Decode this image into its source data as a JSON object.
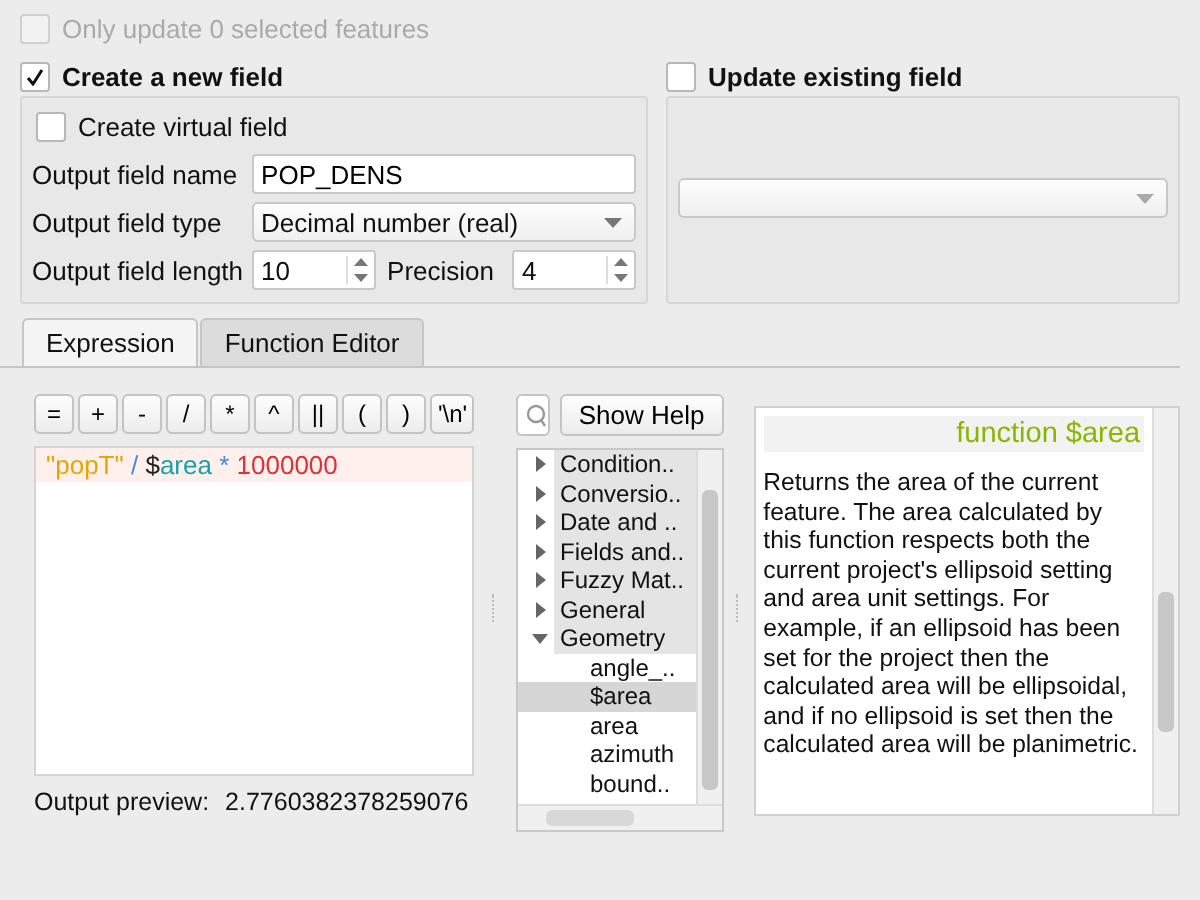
{
  "only_update": {
    "label": "Only update 0 selected features",
    "checked": false,
    "disabled": true
  },
  "create_new": {
    "label": "Create a new field",
    "checked": true,
    "virtual": {
      "label": "Create virtual field",
      "checked": false
    },
    "name_label": "Output field name",
    "name_value": "POP_DENS",
    "type_label": "Output field type",
    "type_value": "Decimal number (real)",
    "length_label": "Output field length",
    "length_value": "10",
    "precision_label": "Precision",
    "precision_value": "4"
  },
  "update_existing": {
    "label": "Update existing field",
    "checked": false
  },
  "tabs": [
    {
      "label": "Expression",
      "selected": true
    },
    {
      "label": "Function Editor",
      "selected": false
    }
  ],
  "operators": [
    "=",
    "+",
    "-",
    "/",
    "*",
    "^",
    "||",
    "(",
    ")",
    "'\\n'"
  ],
  "expression": [
    {
      "text": "\"popT\"",
      "kind": "string"
    },
    {
      "text": " / ",
      "kind": "operator"
    },
    {
      "text": "$",
      "kind": "plain"
    },
    {
      "text": "area",
      "kind": "function"
    },
    {
      "text": " * ",
      "kind": "operator"
    },
    {
      "text": "1000000",
      "kind": "number"
    }
  ],
  "output_preview": {
    "label": "Output preview:",
    "value": "2.7760382378259076"
  },
  "show_help": "Show Help",
  "tree": [
    {
      "label": "Condition..",
      "expanded": false
    },
    {
      "label": "Conversio..",
      "expanded": false
    },
    {
      "label": "Date and ..",
      "expanded": false
    },
    {
      "label": "Fields and..",
      "expanded": false
    },
    {
      "label": "Fuzzy Mat..",
      "expanded": false
    },
    {
      "label": "General",
      "expanded": false
    },
    {
      "label": "Geometry",
      "expanded": true,
      "children": [
        {
          "label": "angle_..",
          "selected": false
        },
        {
          "label": "$area",
          "selected": true
        },
        {
          "label": "area",
          "selected": false
        },
        {
          "label": "azimuth",
          "selected": false
        },
        {
          "label": "bound..",
          "selected": false
        }
      ]
    }
  ],
  "help": {
    "title": "function $area",
    "text": "Returns the area of the current feature. The area calculated by this function respects both the current project's ellipsoid setting and area unit settings. For example, if an ellipsoid has been set for the project then the calculated area will be ellipsoidal, and if no ellipsoid is set then the calculated area will be planimetric."
  }
}
